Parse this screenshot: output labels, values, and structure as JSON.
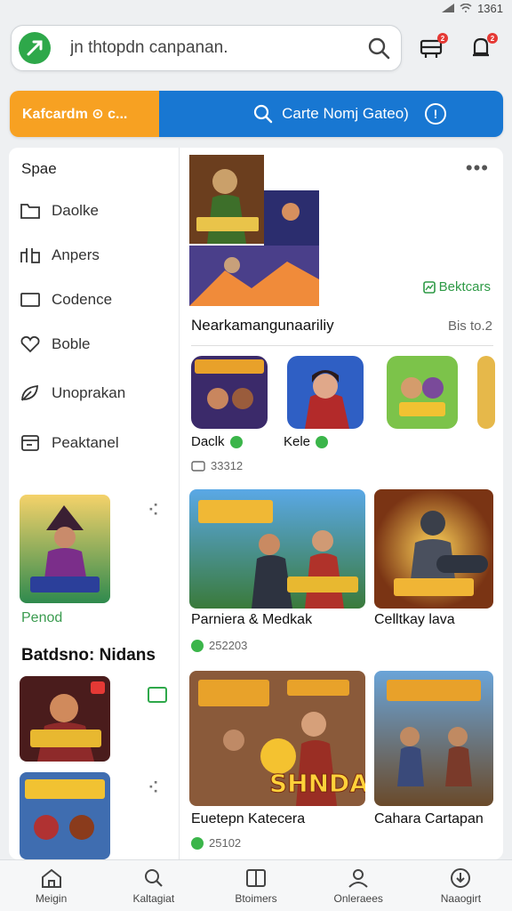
{
  "status_bar": {
    "time": "1361"
  },
  "search": {
    "placeholder": "jn thtopdn canpanan."
  },
  "header": {
    "notification_count": "2",
    "download_count": "2"
  },
  "segment": {
    "left_label": "Kafcardm ⊙ c...",
    "right_label": "Carte Nomj Gateo)",
    "info_icon": "info-icon"
  },
  "sidebar": {
    "heading": "Spae",
    "items": [
      {
        "label": "Daolke",
        "icon": "folder-icon"
      },
      {
        "label": "Anpers",
        "icon": "puzzle-icon"
      },
      {
        "label": "Codence",
        "icon": "window-icon"
      },
      {
        "label": "Boble",
        "icon": "heart-icon"
      },
      {
        "label": "Unoprakan",
        "icon": "leaf-icon"
      },
      {
        "label": "Peaktanel",
        "icon": "card-icon"
      }
    ],
    "featured_label": "Penod",
    "section_title": "Batdsno: Nidans"
  },
  "main": {
    "see_all": "Bektcars",
    "section_title": "Nearkamangunaariliy",
    "section_count": "Bis to.2",
    "apps": [
      {
        "name": "Daclk",
        "badge": true
      },
      {
        "name": "Kele",
        "badge": true
      }
    ],
    "apps_meta": "33312",
    "tiles": [
      {
        "title": "Parniera & Medkak",
        "meta": "252203"
      },
      {
        "title": "Celltkay lava",
        "meta": ""
      },
      {
        "title": "Euetepn Katecera",
        "meta": "25102"
      },
      {
        "title": "Cahara Cartapan",
        "meta": ""
      }
    ],
    "tile_text_1": "SHNDAK"
  },
  "bottom_nav": [
    {
      "label": "Meigin",
      "icon": "home-icon"
    },
    {
      "label": "Kaltagiat",
      "icon": "search-icon"
    },
    {
      "label": "Btoimers",
      "icon": "book-icon"
    },
    {
      "label": "Onleraees",
      "icon": "person-icon"
    },
    {
      "label": "Naaogirt",
      "icon": "download-icon"
    }
  ],
  "colors": {
    "orange": "#f7a122",
    "blue": "#1877d2",
    "green": "#2ea84a",
    "red": "#e53935"
  }
}
